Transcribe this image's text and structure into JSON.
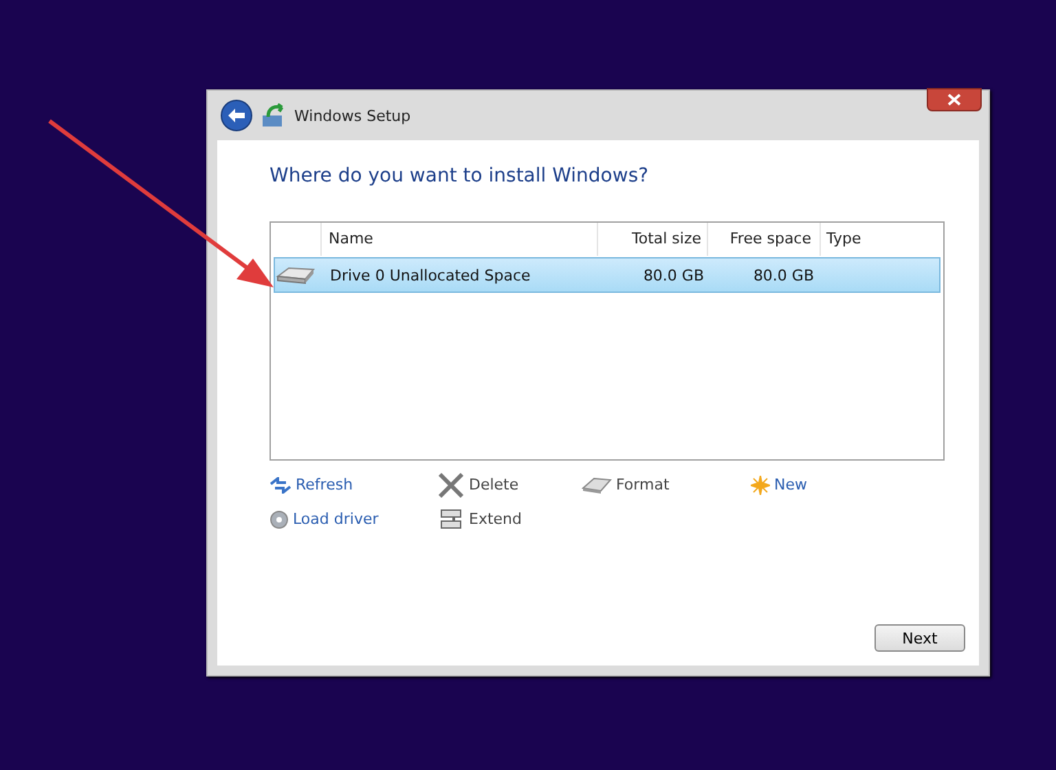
{
  "window": {
    "title": "Windows Setup"
  },
  "heading": "Where do you want to install Windows?",
  "table": {
    "columns": [
      "Name",
      "Total size",
      "Free space",
      "Type"
    ],
    "rows": [
      {
        "name": "Drive 0 Unallocated Space",
        "total_size": "80.0 GB",
        "free_space": "80.0 GB",
        "selected": true
      }
    ]
  },
  "actions": [
    {
      "kind": "refresh",
      "label": "Refresh",
      "disabled": false
    },
    {
      "kind": "delete",
      "label": "Delete",
      "disabled": true
    },
    {
      "kind": "format",
      "label": "Format",
      "disabled": true
    },
    {
      "kind": "new",
      "label": "New",
      "disabled": false
    },
    {
      "kind": "load",
      "label": "Load driver",
      "disabled": false
    },
    {
      "kind": "extend",
      "label": "Extend",
      "disabled": true
    }
  ],
  "buttons": [
    "Next"
  ]
}
